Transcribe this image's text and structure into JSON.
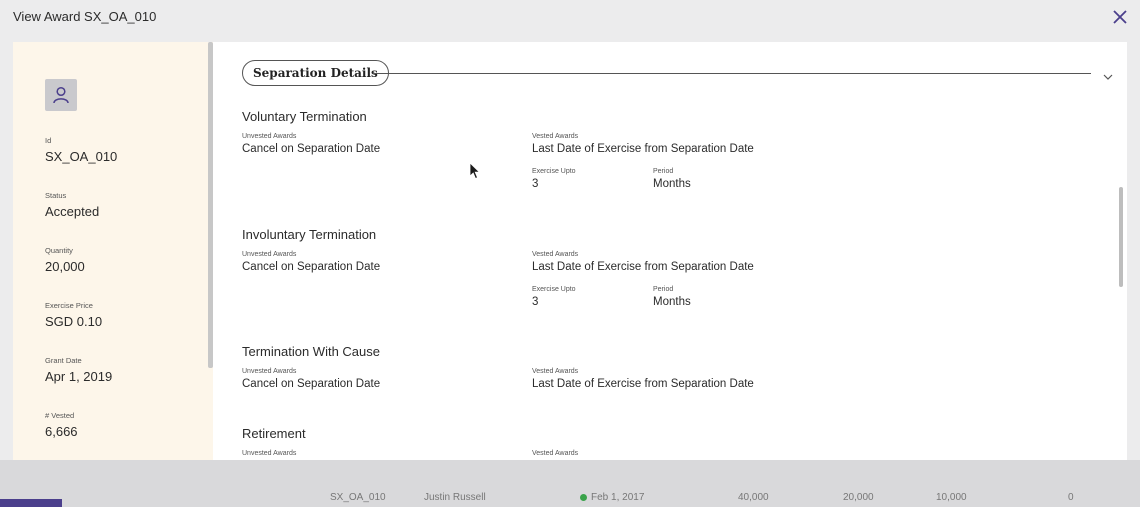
{
  "modal": {
    "title": "View Award SX_OA_010"
  },
  "award": {
    "fields": [
      {
        "label": "Id",
        "value": "SX_OA_010"
      },
      {
        "label": "Status",
        "value": "Accepted"
      },
      {
        "label": "Quantity",
        "value": "20,000"
      },
      {
        "label": "Exercise Price",
        "value": "SGD 0.10"
      },
      {
        "label": "Grant Date",
        "value": "Apr 1, 2019"
      },
      {
        "label": "# Vested",
        "value": "6,666"
      }
    ]
  },
  "section": {
    "title": "Separation Details",
    "blocks": [
      {
        "title": "Voluntary Termination",
        "unvested_label": "Unvested Awards",
        "unvested_value": "Cancel on Separation Date",
        "vested_label": "Vested Awards",
        "vested_value": "Last Date of Exercise from Separation Date",
        "exercise_label": "Exercise Upto",
        "exercise_value": "3",
        "period_label": "Period",
        "period_value": "Months"
      },
      {
        "title": "Involuntary Termination",
        "unvested_label": "Unvested Awards",
        "unvested_value": "Cancel on Separation Date",
        "vested_label": "Vested Awards",
        "vested_value": "Last Date of Exercise from Separation Date",
        "exercise_label": "Exercise Upto",
        "exercise_value": "3",
        "period_label": "Period",
        "period_value": "Months"
      },
      {
        "title": "Termination With Cause",
        "unvested_label": "Unvested Awards",
        "unvested_value": "Cancel on Separation Date",
        "vested_label": "Vested Awards",
        "vested_value": "Last Date of Exercise from Separation Date"
      },
      {
        "title": "Retirement",
        "unvested_label": "Unvested Awards",
        "vested_label": "Vested Awards"
      }
    ]
  },
  "background_row": {
    "id": "SX_OA_010",
    "name": "Justin Russell",
    "date": "Feb 1, 2017",
    "v1": "40,000",
    "v2": "20,000",
    "v3": "10,000",
    "v4": "0"
  },
  "colors": {
    "accent": "#4b3f8c",
    "left_panel": "#fdf6ea",
    "status_green": "#3aa34a"
  },
  "icons": {
    "close": "close-icon",
    "avatar": "user-icon",
    "chevron": "chevron-down-icon",
    "cursor": "mouse-pointer-icon"
  }
}
